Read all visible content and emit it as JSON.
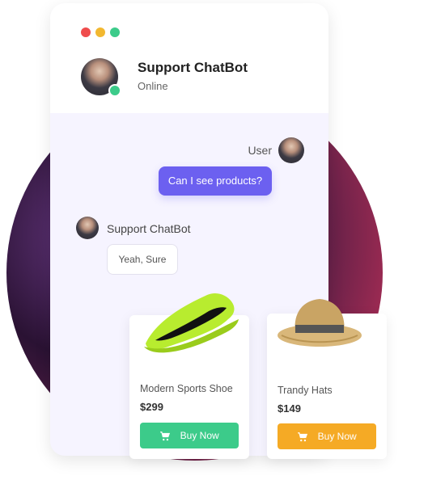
{
  "header": {
    "bot_name": "Support ChatBot",
    "status": "Online"
  },
  "chat": {
    "user_label": "User",
    "user_message": "Can I see products?",
    "bot_label": "Support ChatBot",
    "bot_message": "Yeah, Sure"
  },
  "products": [
    {
      "name": "Modern Sports Shoe",
      "price": "$299",
      "button": "Buy Now"
    },
    {
      "name": "Trandy Hats",
      "price": "$149",
      "button": "Buy Now"
    }
  ],
  "colors": {
    "accent": "#6c60f0",
    "green": "#3ccb8a",
    "orange": "#f5aa25"
  },
  "icons": {
    "window_controls": [
      "close-dot",
      "minimize-dot",
      "maximize-dot"
    ],
    "cart": "cart-icon"
  }
}
